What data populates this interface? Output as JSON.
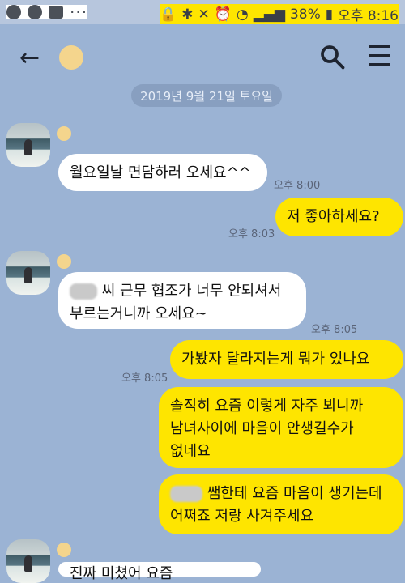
{
  "status_bar": {
    "battery": "38%",
    "time": "오후 8:16",
    "left_icons": [
      "talk-icon",
      "record-icon",
      "gallery-icon",
      "more-dots-icon"
    ],
    "right_icons": [
      "lock-icon",
      "bluetooth-icon",
      "silent-icon",
      "alarm-icon",
      "wifi-icon",
      "signal-icon",
      "battery-icon"
    ]
  },
  "chat": {
    "date": "2019년 9월 21일 토요일",
    "messages": [
      {
        "side": "left",
        "text": "월요일날 면담하러 오세요^^",
        "time": "오후 8:00"
      },
      {
        "side": "right",
        "text": "저 좋아하세요?",
        "time": "오후 8:03"
      },
      {
        "side": "left",
        "lines": [
          "씨 근무 협조가 너무 안되셔서",
          "부르는거니까 오세요~"
        ],
        "time": "오후 8:05"
      },
      {
        "side": "right",
        "text": "가봤자 달라지는게 뭐가 있나요",
        "time": "오후 8:05"
      },
      {
        "side": "right",
        "lines": [
          "솔직히 요즘 이렇게 자주 뵈니까",
          "남녀사이에 마음이 안생길수가",
          "없네요"
        ]
      },
      {
        "side": "right",
        "lines": [
          "쌤한테 요즘 마음이 생기는데",
          "어쩌죠 저랑 사겨주세요"
        ]
      }
    ],
    "partial_last_line": "진짜 미쳤어 요즘"
  },
  "colors": {
    "bg": "#9bb3d4",
    "status_bg": "#b7c6dd",
    "left_bubble": "#ffffff",
    "right_bubble": "#fee500",
    "time_text": "#5a6478"
  }
}
